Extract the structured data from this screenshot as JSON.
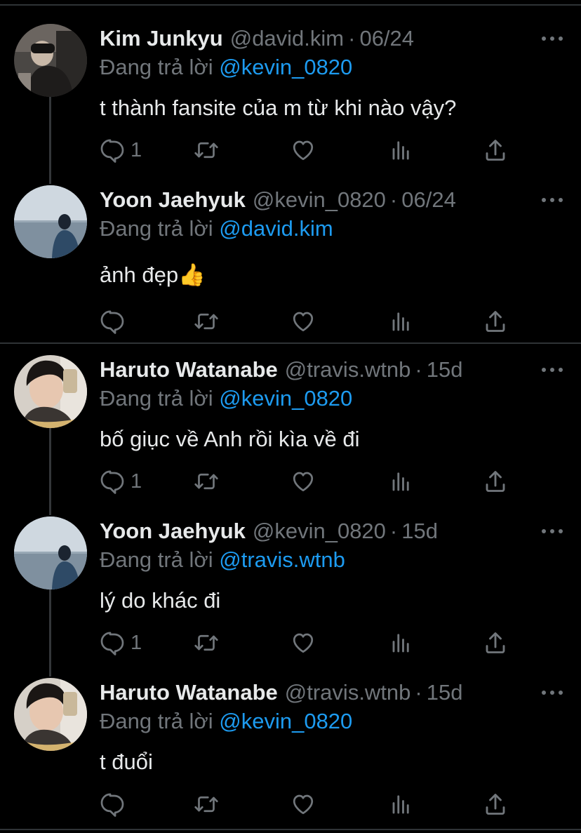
{
  "tweets": [
    {
      "name": "Kim Junkyu",
      "handle": "@david.kim",
      "date": "06/24",
      "reply_prefix": "Đang trả lời",
      "reply_to": "@kevin_0820",
      "text": "t thành fansite của m từ khi nào vậy?",
      "reply_count": "1",
      "avatar": "dark-photo-avatar"
    },
    {
      "name": "Yoon Jaehyuk",
      "handle": "@kevin_0820",
      "date": "06/24",
      "reply_prefix": "Đang trả lời",
      "reply_to": "@david.kim",
      "text": "ảnh đẹp",
      "emoji": "👍",
      "reply_count": "",
      "avatar": "seaside-avatar"
    },
    {
      "name": "Haruto Watanabe",
      "handle": "@travis.wtnb",
      "date": "15d",
      "reply_prefix": "Đang trả lời",
      "reply_to": "@kevin_0820",
      "text": "bố giục về Anh rồi kìa về đi",
      "reply_count": "1",
      "avatar": "mirror-selfie-avatar"
    },
    {
      "name": "Yoon Jaehyuk",
      "handle": "@kevin_0820",
      "date": "15d",
      "reply_prefix": "Đang trả lời",
      "reply_to": "@travis.wtnb",
      "text": "lý do khác đi",
      "reply_count": "1",
      "avatar": "seaside-avatar"
    },
    {
      "name": "Haruto Watanabe",
      "handle": "@travis.wtnb",
      "date": "15d",
      "reply_prefix": "Đang trả lời",
      "reply_to": "@kevin_0820",
      "text": "t đuổi",
      "reply_count": "",
      "avatar": "mirror-selfie-avatar"
    }
  ],
  "icons": [
    "reply-icon",
    "retweet-icon",
    "like-icon",
    "analytics-icon",
    "share-icon",
    "more-icon"
  ],
  "colors": {
    "background": "#000000",
    "text": "#e7e9ea",
    "secondary": "#71767b",
    "mention": "#1d9bf0",
    "divider": "#2f3336"
  }
}
